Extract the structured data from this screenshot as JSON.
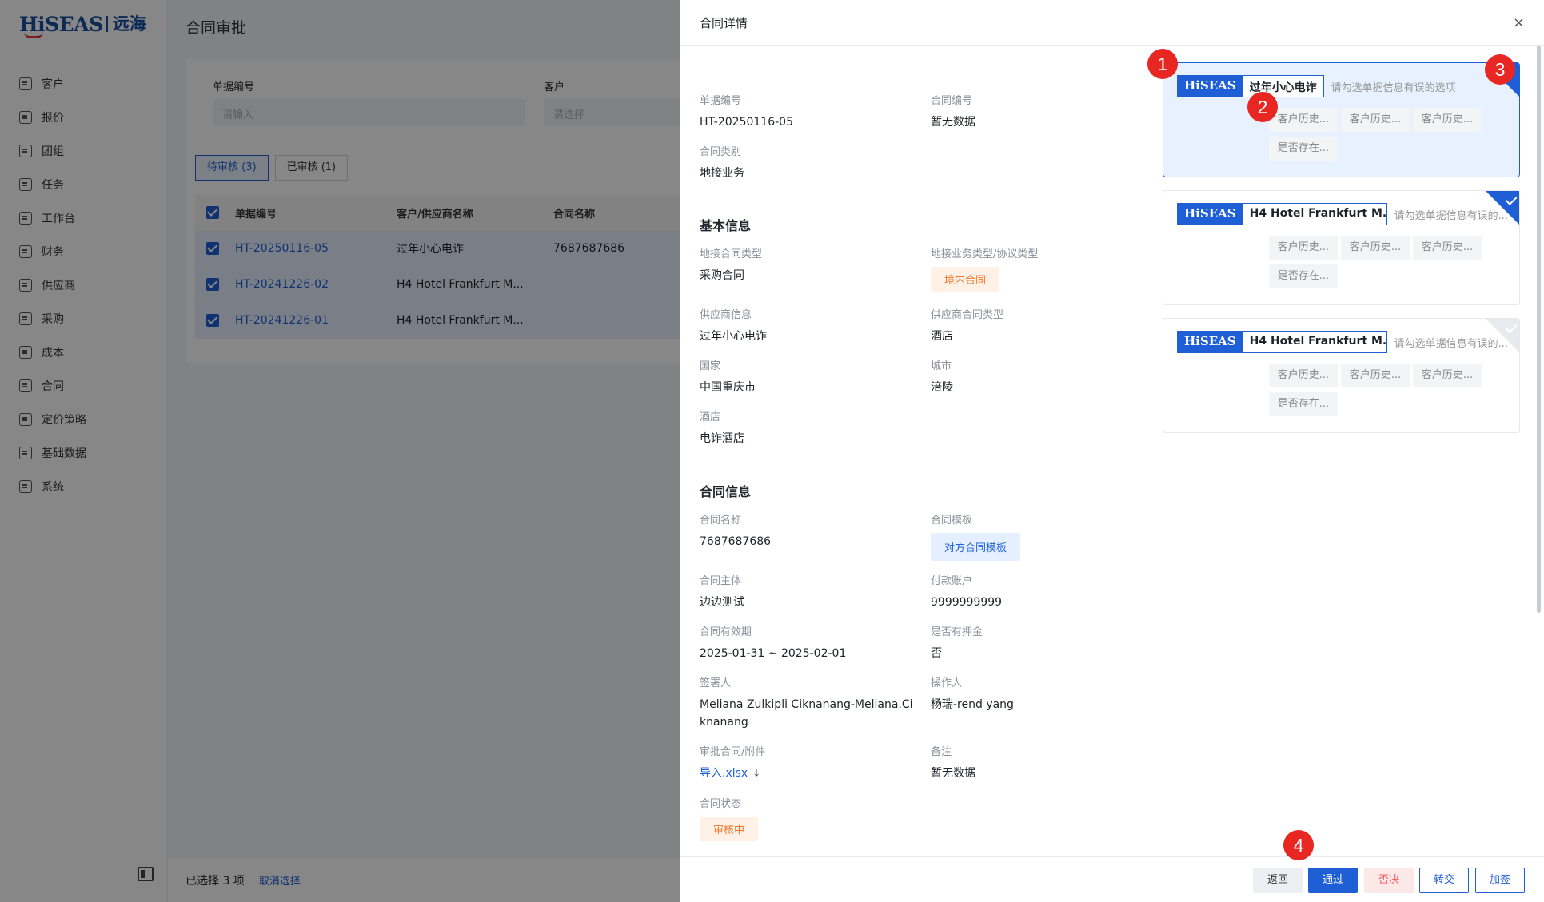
{
  "brand": {
    "logo_en": "HiSEAS",
    "logo_cn": "远海"
  },
  "sidebar": {
    "items": [
      {
        "label": "客户"
      },
      {
        "label": "报价"
      },
      {
        "label": "团组"
      },
      {
        "label": "任务"
      },
      {
        "label": "工作台"
      },
      {
        "label": "财务"
      },
      {
        "label": "供应商"
      },
      {
        "label": "采购"
      },
      {
        "label": "成本"
      },
      {
        "label": "合同"
      },
      {
        "label": "定价策略"
      },
      {
        "label": "基础数据"
      },
      {
        "label": "系统"
      }
    ]
  },
  "page": {
    "title": "合同审批"
  },
  "filters": {
    "doc_no_label": "单据编号",
    "doc_no_placeholder": "请输入",
    "customer_label": "客户",
    "customer_placeholder": "请选择"
  },
  "tabs": [
    {
      "label": "待审核 (3)"
    },
    {
      "label": "已审核 (1)"
    }
  ],
  "table": {
    "headers": [
      "单据编号",
      "客户/供应商名称",
      "合同名称"
    ],
    "rows": [
      {
        "doc_no": "HT-20250116-05",
        "party": "过年小心电诈",
        "contract": "7687687686"
      },
      {
        "doc_no": "HT-20241226-02",
        "party": "H4 Hotel Frankfurt M...",
        "contract": ""
      },
      {
        "doc_no": "HT-20241226-01",
        "party": "H4 Hotel Frankfurt M...",
        "contract": ""
      }
    ]
  },
  "bottombar": {
    "selected": "已选择 3 项",
    "cancel": "取消选择"
  },
  "drawer": {
    "title": "合同详情",
    "close": "×",
    "top": {
      "doc_no_label": "单据编号",
      "doc_no": "HT-20250116-05",
      "contract_no_label": "合同编号",
      "contract_no": "暂无数据",
      "category_label": "合同类别",
      "category": "地接业务"
    },
    "basic": {
      "title": "基本信息",
      "ground_type_label": "地接合同类型",
      "ground_type": "采购合同",
      "biz_type_label": "地接业务类型/协议类型",
      "biz_type": "境内合同",
      "supplier_label": "供应商信息",
      "supplier": "过年小心电诈",
      "supplier_type_label": "供应商合同类型",
      "supplier_type": "酒店",
      "country_label": "国家",
      "country": "中国重庆市",
      "city_label": "城市",
      "city": "涪陵",
      "hotel_label": "酒店",
      "hotel": "电诈酒店"
    },
    "contract": {
      "title": "合同信息",
      "name_label": "合同名称",
      "name": "7687687686",
      "template_label": "合同模板",
      "template": "对方合同模板",
      "subject_label": "合同主体",
      "subject": "边边测试",
      "account_label": "付款账户",
      "account": "9999999999",
      "validity_label": "合同有效期",
      "validity": "2025-01-31 ~ 2025-02-01",
      "deposit_label": "是否有押金",
      "deposit": "否",
      "signer_label": "签署人",
      "signer": "Meliana Zulkipli Ciknanang-Meliana.Ciknanang",
      "operator_label": "操作人",
      "operator": "杨瑞-rend yang",
      "attach_label": "审批合同/附件",
      "attach": "导入.xlsx",
      "remark_label": "备注",
      "remark": "暂无数据",
      "status_label": "合同状态",
      "status": "审核中"
    },
    "cards": [
      {
        "brand": "HiSEAS",
        "name": "过年小心电诈",
        "hint": "请勾选单据信息有误的选项",
        "options": [
          "客户历史...",
          "客户历史...",
          "客户历史...",
          "是否存在..."
        ]
      },
      {
        "brand": "HiSEAS",
        "name": "H4 Hotel Frankfurt M...",
        "hint": "请勾选单据信息有误的...",
        "options": [
          "客户历史...",
          "客户历史...",
          "客户历史...",
          "是否存在..."
        ]
      },
      {
        "brand": "HiSEAS",
        "name": "H4 Hotel Frankfurt M...",
        "hint": "请勾选单据信息有误的...",
        "options": [
          "客户历史...",
          "客户历史...",
          "客户历史...",
          "是否存在..."
        ]
      }
    ],
    "footer": {
      "back": "返回",
      "approve": "通过",
      "reject": "否决",
      "transfer": "转交",
      "countersign": "加签"
    }
  },
  "annotations": [
    "1",
    "2",
    "3",
    "4"
  ],
  "colors": {
    "primary": "#1f5fd6",
    "danger": "#f35a5a",
    "badge": "#e82622",
    "orange": "#f0782a"
  }
}
